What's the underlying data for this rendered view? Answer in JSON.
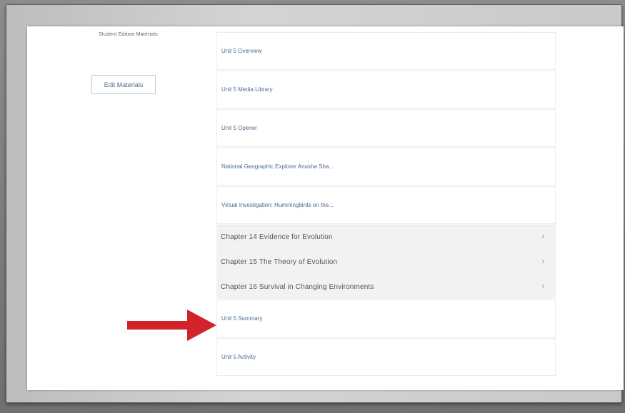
{
  "section_label": "Student Edition Materials",
  "edit_button_label": "Edit Materials",
  "items": [
    {
      "label": "Unit 5 Overview",
      "type": "item"
    },
    {
      "label": "Unit 5 Media Library",
      "type": "item"
    },
    {
      "label": "Unit 5 Opener",
      "type": "item"
    },
    {
      "label": "National Geographic Explorer Anusha Sha...",
      "type": "item"
    },
    {
      "label": "Virtual Investigation: Hummingbirds on the...",
      "type": "item"
    },
    {
      "label": "Chapter 14 Evidence for Evolution",
      "type": "chapter"
    },
    {
      "label": "Chapter 15 The Theory of Evolution",
      "type": "chapter"
    },
    {
      "label": "Chapter 16 Survival in Changing Environments",
      "type": "chapter"
    },
    {
      "label": "Unit 5 Summary",
      "type": "item"
    },
    {
      "label": "Unit 5 Activity",
      "type": "item"
    }
  ],
  "chevron_glyph": "›",
  "colors": {
    "arrow": "#d1232a",
    "link": "#4f6c8c"
  }
}
